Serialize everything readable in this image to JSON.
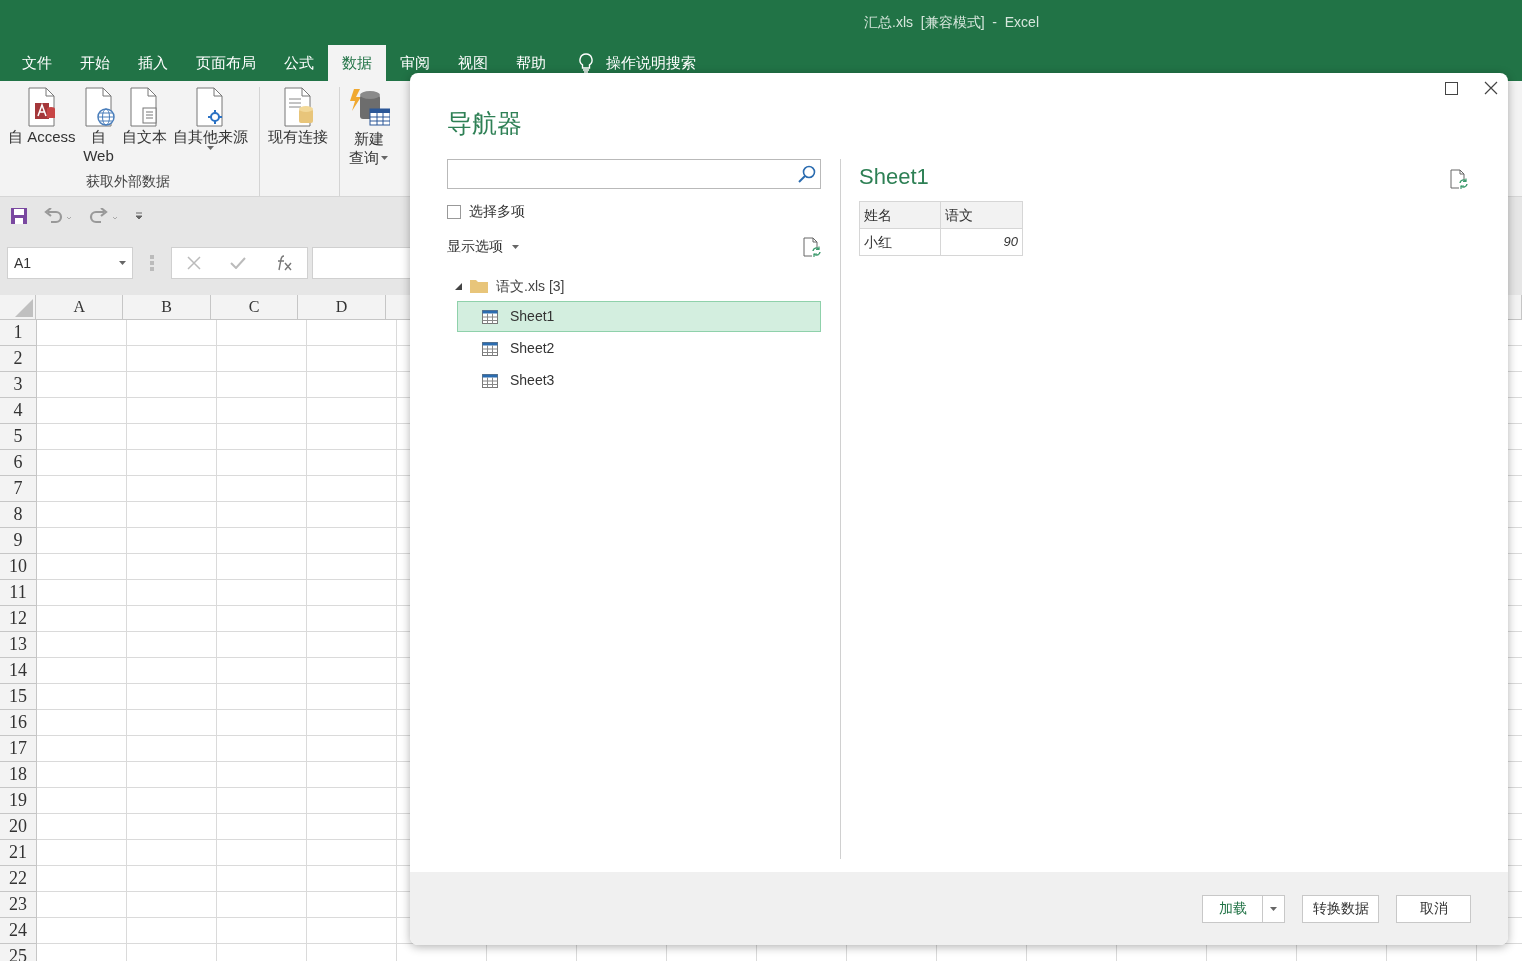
{
  "window": {
    "title": "汇总.xls  [兼容模式]  -  Excel"
  },
  "ribbon_tabs": [
    {
      "label": "文件",
      "selected": false
    },
    {
      "label": "开始",
      "selected": false
    },
    {
      "label": "插入",
      "selected": false
    },
    {
      "label": "页面布局",
      "selected": false
    },
    {
      "label": "公式",
      "selected": false
    },
    {
      "label": "数据",
      "selected": true
    },
    {
      "label": "审阅",
      "selected": false
    },
    {
      "label": "视图",
      "selected": false
    },
    {
      "label": "帮助",
      "selected": false
    }
  ],
  "tell_me": "操作说明搜索",
  "ribbon_groups": [
    {
      "label": "获取外部数据",
      "buttons": [
        {
          "kind": "access",
          "lines": [
            "自 Access"
          ],
          "dropdown": false
        },
        {
          "kind": "web",
          "lines": [
            "自",
            "Web"
          ],
          "dropdown": false
        },
        {
          "kind": "text",
          "lines": [
            "自文本"
          ],
          "dropdown": false
        },
        {
          "kind": "other",
          "lines": [
            "自其他来源"
          ],
          "dropdown": true
        }
      ]
    },
    {
      "buttons": [
        {
          "kind": "connection",
          "lines": [
            "现有连接"
          ],
          "dropdown": false
        }
      ]
    },
    {
      "buttons": [
        {
          "kind": "query",
          "lines": [
            "新建",
            "查询"
          ],
          "dropdown": true
        }
      ]
    }
  ],
  "name_box": "A1",
  "columns": [
    "A",
    "B",
    "C",
    "D"
  ],
  "rows": [
    "1",
    "2",
    "3",
    "4",
    "5",
    "6",
    "7",
    "8",
    "9",
    "10",
    "11",
    "12",
    "13",
    "14",
    "15",
    "16",
    "17",
    "18",
    "19",
    "20",
    "21",
    "22",
    "23",
    "24",
    "25"
  ],
  "dialog": {
    "title": "导航器",
    "multi_select": {
      "label": "选择多项",
      "checked": false
    },
    "display_options": "显示选项",
    "tree": {
      "label": "语文.xls",
      "count": "[3]",
      "expanded": true,
      "children": [
        {
          "label": "Sheet1",
          "selected": true
        },
        {
          "label": "Sheet2",
          "selected": false
        },
        {
          "label": "Sheet3",
          "selected": false
        }
      ]
    },
    "preview": {
      "title": "Sheet1",
      "columns": [
        "姓名",
        "语文"
      ],
      "rows": [
        [
          "小红",
          "90"
        ]
      ]
    },
    "buttons": {
      "load": "加载",
      "transform": "转换数据",
      "cancel": "取消"
    }
  }
}
